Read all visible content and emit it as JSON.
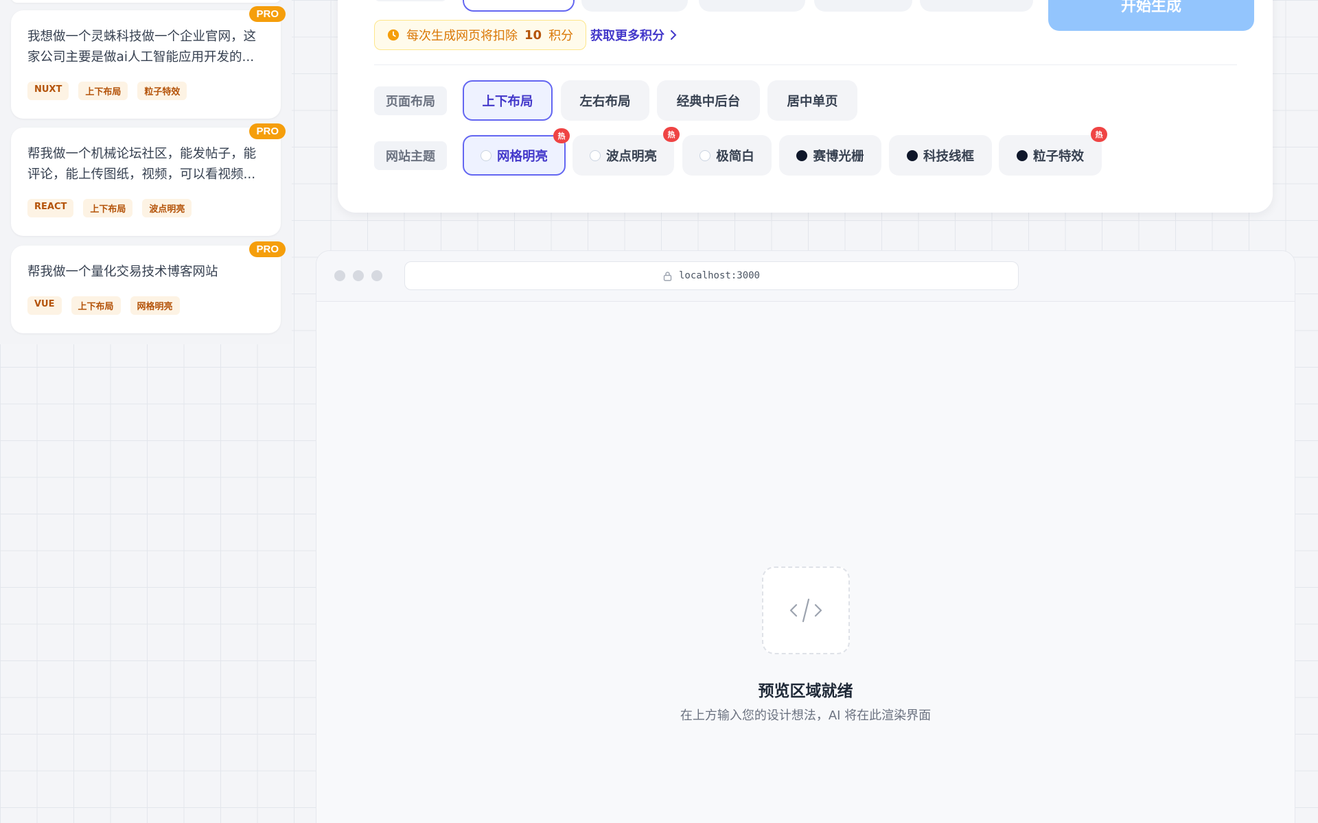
{
  "cases": [
    {
      "description": "我想做一个灵蛛科技做一个企业官网，这家公司主要是做ai人工智能应用开发的...",
      "badge": "PRO",
      "tags": [
        "NUXT",
        "上下布局",
        "粒子特效"
      ]
    },
    {
      "description": "帮我做一个机械论坛社区，能发帖子，能评论，能上传图纸，视频，可以看视频...",
      "badge": "PRO",
      "tags": [
        "REACT",
        "上下布局",
        "波点明亮"
      ]
    },
    {
      "description": "帮我做一个量化交易技术博客网站",
      "badge": "PRO",
      "tags": [
        "VUE",
        "上下布局",
        "网格明亮"
      ]
    }
  ],
  "config": {
    "start_button": "开始生成",
    "cost_notice_prefix": "每次生成网页将扣除",
    "cost_amount": "10",
    "cost_unit": "积分",
    "more_points_link": "获取更多积分",
    "layout_label": "页面布局",
    "layout_options": [
      "上下布局",
      "左右布局",
      "经典中后台",
      "居中单页"
    ],
    "layout_selected": "上下布局",
    "theme_label": "网站主题",
    "theme_options": [
      "网格明亮",
      "波点明亮",
      "极简白",
      "赛博光栅",
      "科技线框",
      "粒子特效"
    ],
    "theme_selected": "网格明亮",
    "hot_badge": "热"
  },
  "preview": {
    "url": "localhost:3000",
    "title": "预览区域就绪",
    "subtitle": "在上方输入您的设计想法，AI 将在此渲染界面"
  },
  "colors": {
    "accent": "#6366f1",
    "pro_badge": "#f59e0b",
    "hot_badge": "#ef4444",
    "start_button": "#93c5fd"
  }
}
